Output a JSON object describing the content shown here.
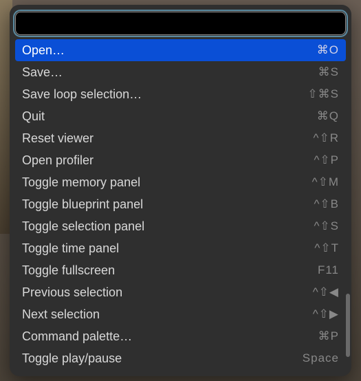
{
  "search": {
    "value": "",
    "placeholder": ""
  },
  "commands": [
    {
      "label": "Open…",
      "shortcut": "⌘O",
      "highlighted": true
    },
    {
      "label": "Save…",
      "shortcut": "⌘S",
      "highlighted": false
    },
    {
      "label": "Save loop selection…",
      "shortcut": "⇧⌘S",
      "highlighted": false
    },
    {
      "label": "Quit",
      "shortcut": "⌘Q",
      "highlighted": false
    },
    {
      "label": "Reset viewer",
      "shortcut": "^⇧R",
      "highlighted": false
    },
    {
      "label": "Open profiler",
      "shortcut": "^⇧P",
      "highlighted": false
    },
    {
      "label": "Toggle memory panel",
      "shortcut": "^⇧M",
      "highlighted": false
    },
    {
      "label": "Toggle blueprint panel",
      "shortcut": "^⇧B",
      "highlighted": false
    },
    {
      "label": "Toggle selection panel",
      "shortcut": "^⇧S",
      "highlighted": false
    },
    {
      "label": "Toggle time panel",
      "shortcut": "^⇧T",
      "highlighted": false
    },
    {
      "label": "Toggle fullscreen",
      "shortcut": "F11",
      "highlighted": false
    },
    {
      "label": "Previous selection",
      "shortcut": "^⇧◀",
      "highlighted": false
    },
    {
      "label": "Next selection",
      "shortcut": "^⇧▶",
      "highlighted": false
    },
    {
      "label": "Command palette…",
      "shortcut": "⌘P",
      "highlighted": false
    },
    {
      "label": "Toggle play/pause",
      "shortcut": "Space",
      "highlighted": false
    }
  ]
}
